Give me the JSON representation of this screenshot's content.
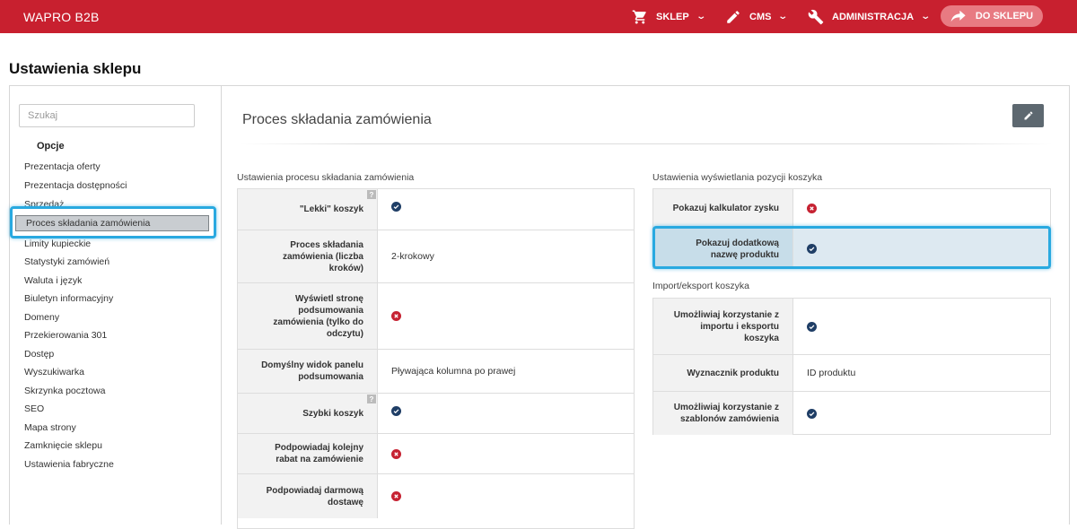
{
  "topbar": {
    "brand": "WAPRO B2B",
    "nav": [
      {
        "label": "SKLEP",
        "icon": "cart-icon"
      },
      {
        "label": "CMS",
        "icon": "pencil-icon"
      },
      {
        "label": "ADMINISTRACJA",
        "icon": "wrench-icon"
      }
    ],
    "shop_button": "DO SKLEPU"
  },
  "page_title": "Ustawienia sklepu",
  "sidebar": {
    "search_placeholder": "Szukaj",
    "group_label": "Opcje",
    "items": [
      "Prezentacja oferty",
      "Prezentacja dostępności",
      "Sprzedaż",
      "Proces składania zamówienia",
      "Limity kupieckie",
      "Statystyki zamówień",
      "Waluta i język",
      "Biuletyn informacyjny",
      "Domeny",
      "Przekierowania 301",
      "Dostęp",
      "Wyszukiwarka",
      "Skrzynka pocztowa",
      "SEO",
      "Mapa strony",
      "Zamknięcie sklepu",
      "Ustawienia fabryczne"
    ],
    "active_item": "Proces składania zamówienia"
  },
  "content": {
    "title": "Proces składania zamówienia",
    "left_section": {
      "label": "Ustawienia procesu składania zamówienia",
      "rows": [
        {
          "label": "\"Lekki\" koszyk",
          "type": "ok",
          "value": "",
          "help": "?"
        },
        {
          "label": "Proces składania zamówienia (liczba kroków)",
          "type": "text",
          "value": "2-krokowy",
          "help": ""
        },
        {
          "label": "Wyświetl stronę podsumowania zamówienia (tylko do odczytu)",
          "type": "no",
          "value": "",
          "help": ""
        },
        {
          "label": "Domyślny widok panelu podsumowania",
          "type": "text",
          "value": "Pływająca kolumna po prawej",
          "help": ""
        },
        {
          "label": "Szybki koszyk",
          "type": "ok",
          "value": "",
          "help": "?"
        },
        {
          "label": "Podpowiadaj kolejny rabat na zamówienie",
          "type": "no",
          "value": "",
          "help": ""
        },
        {
          "label": "Podpowiadaj darmową dostawę",
          "type": "no",
          "value": "",
          "help": ""
        }
      ]
    },
    "right_section_1": {
      "label": "Ustawienia wyświetlania pozycji koszyka",
      "rows": [
        {
          "label": "Pokazuj kalkulator zysku",
          "type": "no",
          "value": ""
        },
        {
          "label": "Pokazuj dodatkową nazwę produktu",
          "type": "ok",
          "value": ""
        }
      ]
    },
    "right_section_2": {
      "label": "Import/eksport koszyka",
      "rows": [
        {
          "label": "Umożliwiaj korzystanie z importu i eksportu koszyka",
          "type": "ok",
          "value": ""
        },
        {
          "label": "Wyznacznik produktu",
          "type": "text",
          "value": "ID produktu"
        },
        {
          "label": "Umożliwiaj korzystanie z szablonów zamówienia",
          "type": "ok",
          "value": ""
        }
      ]
    }
  }
}
